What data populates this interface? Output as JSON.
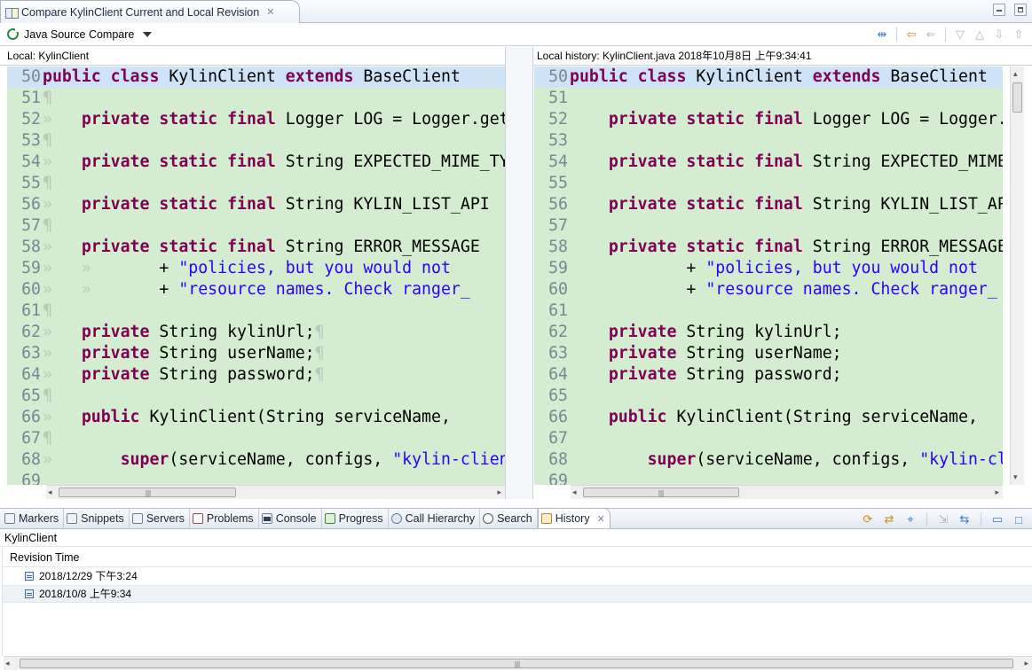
{
  "editor_tab": {
    "title": "Compare KylinClient Current and Local Revision",
    "close": "✕"
  },
  "compare_toolbar": {
    "viewer_label": "Java Source Compare"
  },
  "left_pane": {
    "header": "Local: KylinClient"
  },
  "right_pane": {
    "header": "Local history: KylinClient.java 2018年10月8日 上午9:34:41"
  },
  "code_lines": [
    {
      "num": "50",
      "tokens": [
        [
          "kw",
          "public"
        ],
        [
          "t",
          " "
        ],
        [
          "kw",
          "class"
        ],
        [
          "t",
          " KylinClient "
        ],
        [
          "kw",
          "extends"
        ],
        [
          "t",
          " BaseClient "
        ]
      ],
      "ws": ""
    },
    {
      "num": "51",
      "tokens": [],
      "ws": "¶"
    },
    {
      "num": "52",
      "tokens": [
        [
          "i",
          "    "
        ],
        [
          "kw",
          "private"
        ],
        [
          "t",
          " "
        ],
        [
          "kw",
          "static"
        ],
        [
          "t",
          " "
        ],
        [
          "kw",
          "final"
        ],
        [
          "t",
          " Logger LOG = Logger.getLogger"
        ]
      ],
      "ws": "»"
    },
    {
      "num": "53",
      "tokens": [],
      "ws": "¶"
    },
    {
      "num": "54",
      "tokens": [
        [
          "i",
          "    "
        ],
        [
          "kw",
          "private"
        ],
        [
          "t",
          " "
        ],
        [
          "kw",
          "static"
        ],
        [
          "t",
          " "
        ],
        [
          "kw",
          "final"
        ],
        [
          "t",
          " String EXPECTED_MIME_TYPE"
        ]
      ],
      "ws": "»"
    },
    {
      "num": "55",
      "tokens": [],
      "ws": "¶"
    },
    {
      "num": "56",
      "tokens": [
        [
          "i",
          "    "
        ],
        [
          "kw",
          "private"
        ],
        [
          "t",
          " "
        ],
        [
          "kw",
          "static"
        ],
        [
          "t",
          " "
        ],
        [
          "kw",
          "final"
        ],
        [
          "t",
          " String KYLIN_LIST_API"
        ]
      ],
      "ws": "»"
    },
    {
      "num": "57",
      "tokens": [],
      "ws": "¶"
    },
    {
      "num": "58",
      "tokens": [
        [
          "i",
          "    "
        ],
        [
          "kw",
          "private"
        ],
        [
          "t",
          " "
        ],
        [
          "kw",
          "static"
        ],
        [
          "t",
          " "
        ],
        [
          "kw",
          "final"
        ],
        [
          "t",
          " String ERROR_MESSAGE"
        ]
      ],
      "ws": "»"
    },
    {
      "num": "59",
      "tokens": [
        [
          "i",
          "            "
        ],
        [
          "t",
          "+ "
        ],
        [
          "str",
          "\"policies, but you would not "
        ]
      ],
      "ws": "»   »"
    },
    {
      "num": "60",
      "tokens": [
        [
          "i",
          "            "
        ],
        [
          "t",
          "+ "
        ],
        [
          "str",
          "\"resource names. Check ranger_"
        ]
      ],
      "ws": "»   »"
    },
    {
      "num": "61",
      "tokens": [],
      "ws": "¶"
    },
    {
      "num": "62",
      "tokens": [
        [
          "i",
          "    "
        ],
        [
          "kw",
          "private"
        ],
        [
          "t",
          " String kylinUrl;"
        ]
      ],
      "ws": "»",
      "end": "¶"
    },
    {
      "num": "63",
      "tokens": [
        [
          "i",
          "    "
        ],
        [
          "kw",
          "private"
        ],
        [
          "t",
          " String userName;"
        ]
      ],
      "ws": "»",
      "end": "¶"
    },
    {
      "num": "64",
      "tokens": [
        [
          "i",
          "    "
        ],
        [
          "kw",
          "private"
        ],
        [
          "t",
          " String password;"
        ]
      ],
      "ws": "»",
      "end": "¶"
    },
    {
      "num": "65",
      "tokens": [],
      "ws": "¶"
    },
    {
      "num": "66",
      "tokens": [
        [
          "i",
          "    "
        ],
        [
          "kw",
          "public"
        ],
        [
          "t",
          " KylinClient(String serviceName, "
        ]
      ],
      "ws": "»"
    },
    {
      "num": "67",
      "tokens": [],
      "ws": "¶"
    },
    {
      "num": "68",
      "tokens": [
        [
          "i",
          "        "
        ],
        [
          "kw",
          "super"
        ],
        [
          "t",
          "(serviceName, configs, "
        ],
        [
          "str",
          "\"kylin-client\""
        ]
      ],
      "ws": "»"
    },
    {
      "num": "69",
      "tokens": [],
      "ws": ""
    }
  ],
  "views_tabs": [
    {
      "label": "Markers",
      "icon": "markers-icon"
    },
    {
      "label": "Snippets",
      "icon": "snippets-icon"
    },
    {
      "label": "Servers",
      "icon": "servers-icon"
    },
    {
      "label": "Problems",
      "icon": "problems-icon"
    },
    {
      "label": "Console",
      "icon": "console-icon"
    },
    {
      "label": "Progress",
      "icon": "progress-icon"
    },
    {
      "label": "Call Hierarchy",
      "icon": "call-hierarchy-icon"
    },
    {
      "label": "Search",
      "icon": "search-icon"
    },
    {
      "label": "History",
      "icon": "history-icon",
      "active": true
    }
  ],
  "history": {
    "title": "KylinClient",
    "column": "Revision Time",
    "rows": [
      {
        "time": "2018/12/29 下午3:24",
        "selected": false
      },
      {
        "time": "2018/10/8 上午9:34",
        "selected": true
      }
    ]
  }
}
